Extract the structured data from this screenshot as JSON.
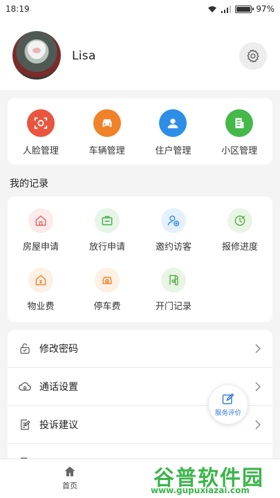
{
  "status_bar": {
    "time": "18:19",
    "battery": "97%"
  },
  "profile": {
    "username": "Lisa"
  },
  "management": [
    {
      "label": "人脸管理",
      "icon": "face-scan-icon",
      "color": "#e9553f"
    },
    {
      "label": "车辆管理",
      "icon": "car-icon",
      "color": "#f0822a"
    },
    {
      "label": "住户管理",
      "icon": "resident-icon",
      "color": "#2d8ee8"
    },
    {
      "label": "小区管理",
      "icon": "building-icon",
      "color": "#45b84a"
    }
  ],
  "records_title": "我的记录",
  "records": [
    {
      "label": "房屋申请",
      "icon": "house-apply-icon",
      "color": "#e46a6a",
      "bg": "#fcebeb"
    },
    {
      "label": "放行申请",
      "icon": "release-icon",
      "color": "#4caf50",
      "bg": "#e6f5e7"
    },
    {
      "label": "邀约访客",
      "icon": "invite-visitor-icon",
      "color": "#3b8fe0",
      "bg": "#e4f1fc"
    },
    {
      "label": "报修进度",
      "icon": "repair-icon",
      "color": "#5fae4f",
      "bg": "#e8f5e4"
    },
    {
      "label": "物业费",
      "icon": "property-fee-icon",
      "color": "#ef8a3a",
      "bg": "#fdf0e4"
    },
    {
      "label": "停车费",
      "icon": "parking-fee-icon",
      "color": "#ef8a3a",
      "bg": "#fdf0e4"
    },
    {
      "label": "开门记录",
      "icon": "door-record-icon",
      "color": "#5fae4f",
      "bg": "#e8f5e4"
    }
  ],
  "menu": [
    {
      "label": "修改密码",
      "icon": "lock-icon"
    },
    {
      "label": "通话设置",
      "icon": "call-settings-icon"
    },
    {
      "label": "投诉建议",
      "icon": "feedback-icon"
    }
  ],
  "fab": {
    "label": "服务评价"
  },
  "bottom_nav": {
    "home_label": "首页"
  },
  "watermark": {
    "main": "谷普软件园",
    "url": "www.gupuxiazai.com"
  }
}
